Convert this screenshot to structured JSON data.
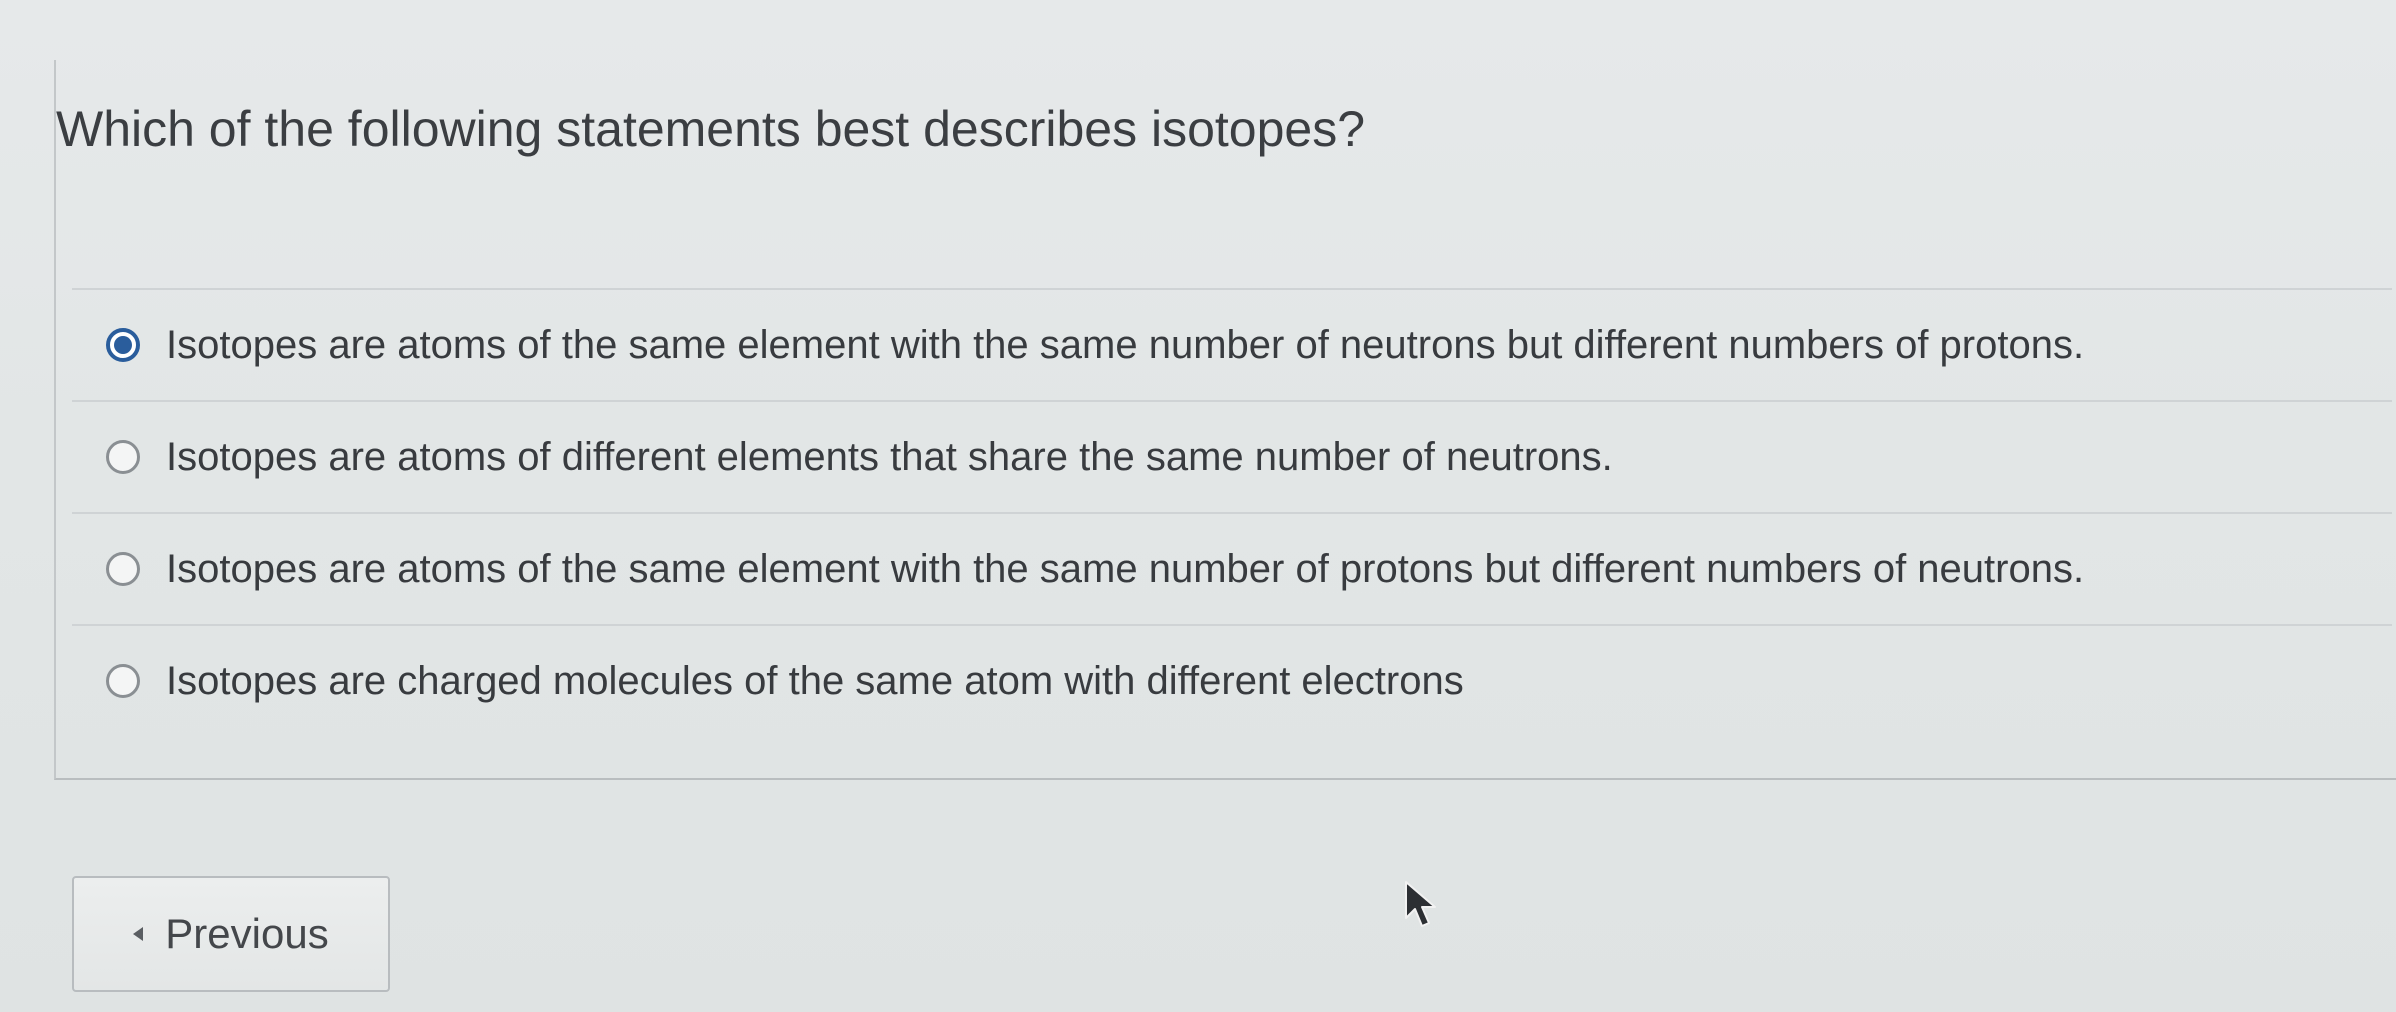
{
  "question": {
    "text": "Which of the following statements best describes isotopes?"
  },
  "answers": [
    {
      "label": "Isotopes are atoms of the same element with the same number of neutrons but different numbers of protons.",
      "selected": true
    },
    {
      "label": "Isotopes are atoms of different elements that share the same number of neutrons.",
      "selected": false
    },
    {
      "label": "Isotopes are atoms of the same element with the same number of protons but different numbers of neutrons.",
      "selected": false
    },
    {
      "label": "Isotopes are charged molecules of the same atom with different electrons",
      "selected": false
    }
  ],
  "navigation": {
    "previous_label": "Previous"
  },
  "colors": {
    "accent": "#2a5d9c",
    "background": "#e2e6e6"
  },
  "icons": {
    "previous": "caret-left-icon",
    "cursor": "mouse-pointer-icon"
  }
}
